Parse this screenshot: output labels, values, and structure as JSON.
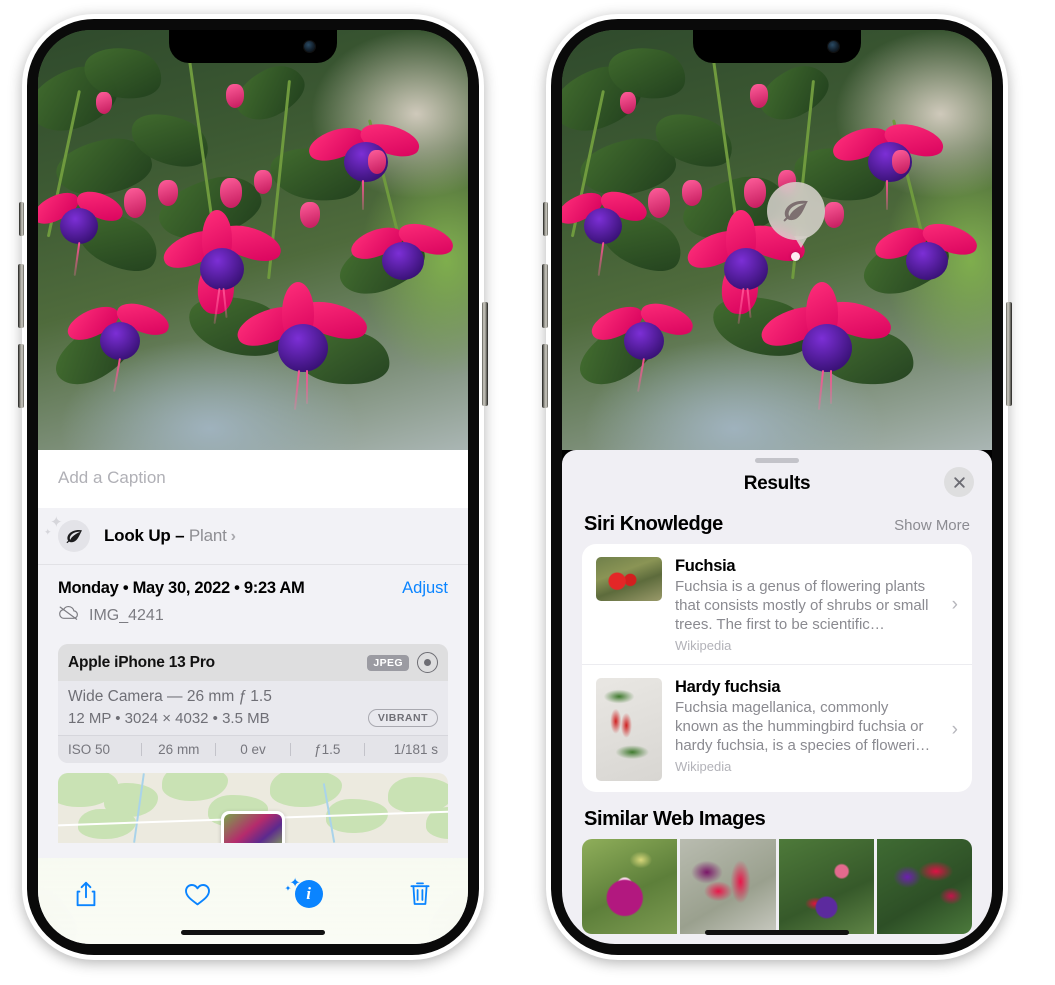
{
  "left_phone": {
    "caption": {
      "placeholder": "Add a Caption",
      "value": ""
    },
    "lookup": {
      "label": "Look Up – ",
      "subject": "Plant",
      "chevron": "›",
      "icon": "leaf-icon"
    },
    "metadata": {
      "date": "Monday • May 30, 2022 • 9:23 AM",
      "adjust_label": "Adjust",
      "filename": "IMG_4241",
      "cloud_icon": "icloud-slash-icon"
    },
    "camera": {
      "model": "Apple iPhone 13 Pro",
      "format_badge": "JPEG",
      "lens_icon": "lens-icon",
      "lens_line": "Wide Camera — 26 mm ƒ 1.5",
      "size_line": "12 MP • 3024 × 4032 • 3.5 MB",
      "style_badge": "VIBRANT",
      "exif": [
        "ISO 50",
        "26 mm",
        "0 ev",
        "ƒ1.5",
        "1/181 s"
      ]
    },
    "toolbar": [
      {
        "name": "share-button",
        "icon": "share-icon"
      },
      {
        "name": "favorite-button",
        "icon": "heart-icon"
      },
      {
        "name": "info-button",
        "icon": "info-sparkle-icon",
        "glyph": "i"
      },
      {
        "name": "delete-button",
        "icon": "trash-icon"
      }
    ],
    "accent_color": "#0a84ff"
  },
  "right_phone": {
    "visual_lookup_badge": {
      "icon": "leaf-icon"
    },
    "sheet": {
      "title": "Results",
      "close_icon": "close-icon"
    },
    "siri_knowledge": {
      "heading": "Siri Knowledge",
      "show_more": "Show More",
      "items": [
        {
          "title": "Fuchsia",
          "description": "Fuchsia is a genus of flowering plants that consists mostly of shrubs or small trees. The first to be scientific…",
          "source": "Wikipedia",
          "chevron": "›"
        },
        {
          "title": "Hardy fuchsia",
          "description": "Fuchsia magellanica, commonly known as the hummingbird fuchsia or hardy fuchsia, is a species of floweri…",
          "source": "Wikipedia",
          "chevron": "›"
        }
      ]
    },
    "similar_web_images": {
      "heading": "Similar Web Images",
      "thumbnails": [
        "fuchsia-thumb-1",
        "fuchsia-thumb-2",
        "fuchsia-thumb-3",
        "fuchsia-thumb-4"
      ]
    }
  }
}
